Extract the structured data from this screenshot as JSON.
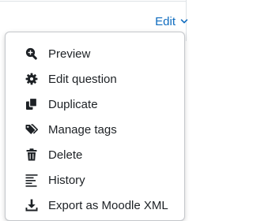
{
  "header": {
    "edit_label": "Edit",
    "edit_icon": "chevron-down-icon"
  },
  "menu": {
    "items": [
      {
        "label": "Preview",
        "icon": "zoom-in-icon"
      },
      {
        "label": "Edit question",
        "icon": "gear-icon"
      },
      {
        "label": "Duplicate",
        "icon": "copy-icon"
      },
      {
        "label": "Manage tags",
        "icon": "tags-icon"
      },
      {
        "label": "Delete",
        "icon": "trash-icon"
      },
      {
        "label": "History",
        "icon": "history-icon"
      },
      {
        "label": "Export as Moodle XML",
        "icon": "download-icon"
      }
    ]
  },
  "colors": {
    "accent": "#0f6cbf",
    "text": "#1d2125",
    "icon": "#1d2125",
    "border": "#c4c7cb"
  }
}
